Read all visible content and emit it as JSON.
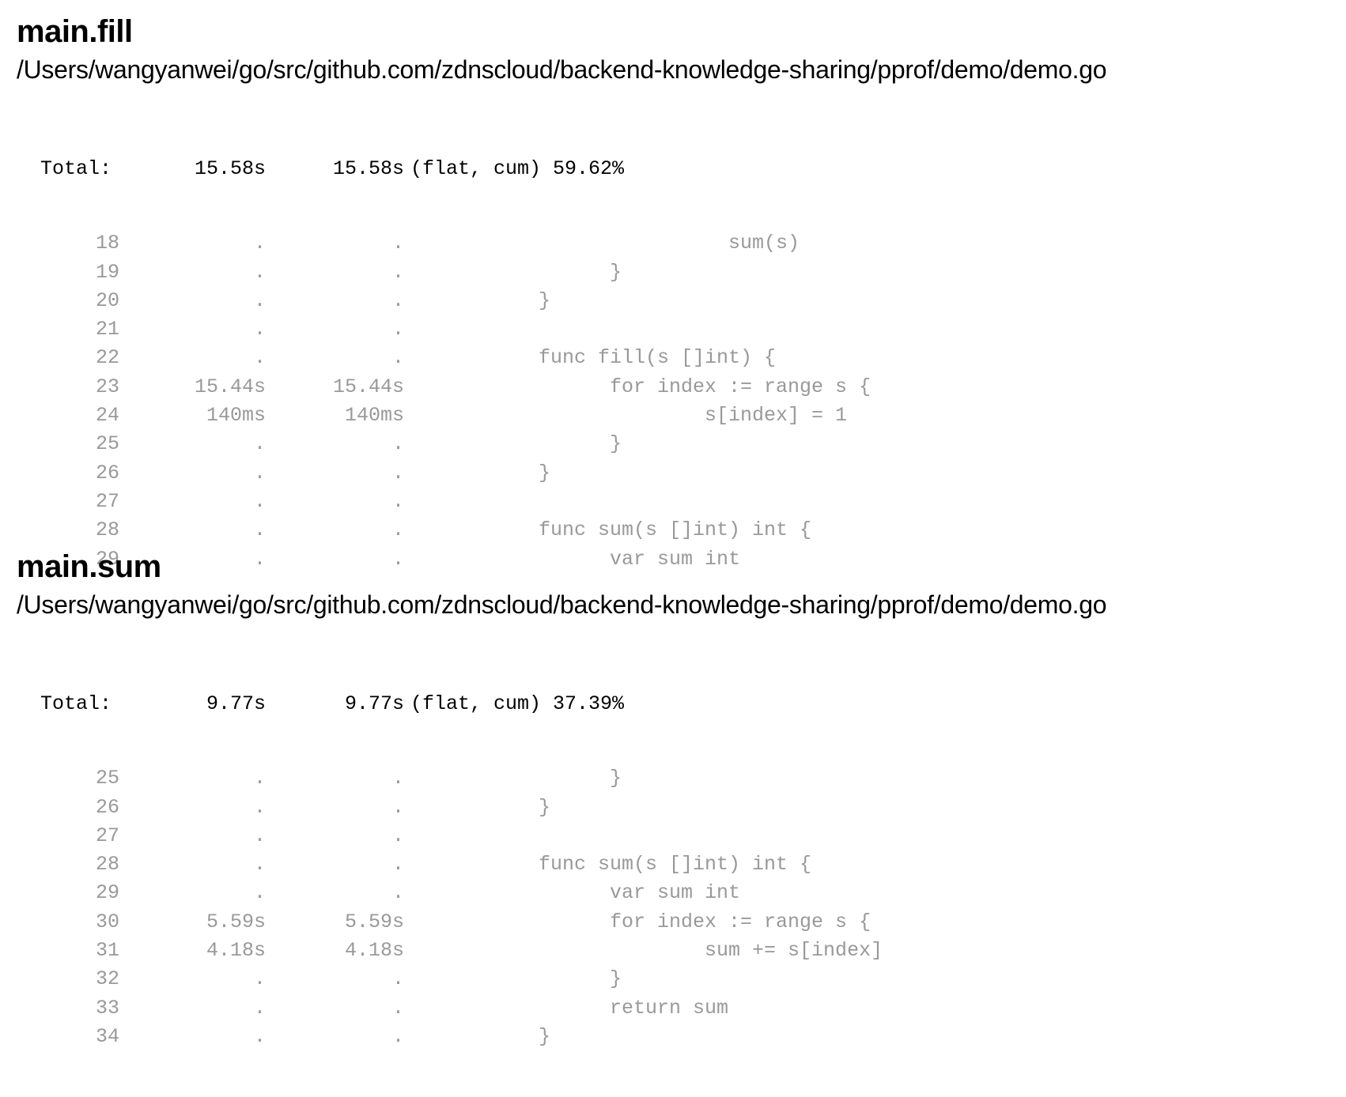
{
  "functions": [
    {
      "name": "main.fill",
      "file": "/Users/wangyanwei/go/src/github.com/zdnscloud/backend-knowledge-sharing/pprof/demo/demo.go",
      "total_label": "Total:",
      "total_flat": "15.58s",
      "total_cum": "15.58s",
      "total_suffix": "(flat, cum) 59.62%",
      "lines": [
        {
          "no": "18",
          "flat": ".",
          "cum": ".",
          "code": "                sum(s)"
        },
        {
          "no": "19",
          "flat": ".",
          "cum": ".",
          "code": "      }"
        },
        {
          "no": "20",
          "flat": ".",
          "cum": ".",
          "code": "}"
        },
        {
          "no": "21",
          "flat": ".",
          "cum": ".",
          "code": ""
        },
        {
          "no": "22",
          "flat": ".",
          "cum": ".",
          "code": "func fill(s []int) {"
        },
        {
          "no": "23",
          "flat": "15.44s",
          "cum": "15.44s",
          "code": "      for index := range s {"
        },
        {
          "no": "24",
          "flat": "140ms",
          "cum": "140ms",
          "code": "              s[index] = 1"
        },
        {
          "no": "25",
          "flat": ".",
          "cum": ".",
          "code": "      }"
        },
        {
          "no": "26",
          "flat": ".",
          "cum": ".",
          "code": "}"
        },
        {
          "no": "27",
          "flat": ".",
          "cum": ".",
          "code": ""
        },
        {
          "no": "28",
          "flat": ".",
          "cum": ".",
          "code": "func sum(s []int) int {"
        },
        {
          "no": "29",
          "flat": ".",
          "cum": ".",
          "code": "      var sum int"
        }
      ]
    },
    {
      "name": "main.sum",
      "file": "/Users/wangyanwei/go/src/github.com/zdnscloud/backend-knowledge-sharing/pprof/demo/demo.go",
      "total_label": "Total:",
      "total_flat": "9.77s",
      "total_cum": "9.77s",
      "total_suffix": "(flat, cum) 37.39%",
      "lines": [
        {
          "no": "25",
          "flat": ".",
          "cum": ".",
          "code": "      }"
        },
        {
          "no": "26",
          "flat": ".",
          "cum": ".",
          "code": "}"
        },
        {
          "no": "27",
          "flat": ".",
          "cum": ".",
          "code": ""
        },
        {
          "no": "28",
          "flat": ".",
          "cum": ".",
          "code": "func sum(s []int) int {"
        },
        {
          "no": "29",
          "flat": ".",
          "cum": ".",
          "code": "      var sum int"
        },
        {
          "no": "30",
          "flat": "5.59s",
          "cum": "5.59s",
          "code": "      for index := range s {"
        },
        {
          "no": "31",
          "flat": "4.18s",
          "cum": "4.18s",
          "code": "              sum += s[index]"
        },
        {
          "no": "32",
          "flat": ".",
          "cum": ".",
          "code": "      }"
        },
        {
          "no": "33",
          "flat": ".",
          "cum": ".",
          "code": "      return sum"
        },
        {
          "no": "34",
          "flat": ".",
          "cum": ".",
          "code": "}"
        }
      ]
    }
  ]
}
